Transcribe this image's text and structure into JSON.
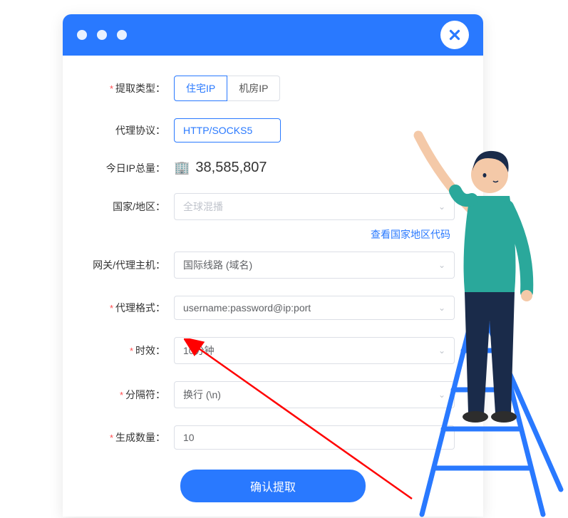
{
  "titlebar": {
    "close_label": "close"
  },
  "form": {
    "extract_type": {
      "label": "提取类型：",
      "required": true,
      "options": [
        "住宅IP",
        "机房IP"
      ],
      "selected": "住宅IP"
    },
    "protocol": {
      "label": "代理协议：",
      "required": false,
      "selected": "HTTP/SOCKS5"
    },
    "ip_total": {
      "label": "今日IP总量：",
      "value": "38,585,807"
    },
    "country": {
      "label": "国家/地区：",
      "placeholder": "全球混播",
      "link": "查看国家地区代码"
    },
    "gateway": {
      "label": "网关/代理主机：",
      "selected": "国际线路 (域名)"
    },
    "format": {
      "label": "代理格式：",
      "required": true,
      "selected": "username:password@ip:port"
    },
    "duration": {
      "label": "时效：",
      "required": true,
      "selected": "10分钟"
    },
    "separator": {
      "label": "分隔符：",
      "required": true,
      "selected": "换行 (\\n)"
    },
    "count": {
      "label": "生成数量：",
      "required": true,
      "value": "10"
    },
    "submit": "确认提取"
  }
}
